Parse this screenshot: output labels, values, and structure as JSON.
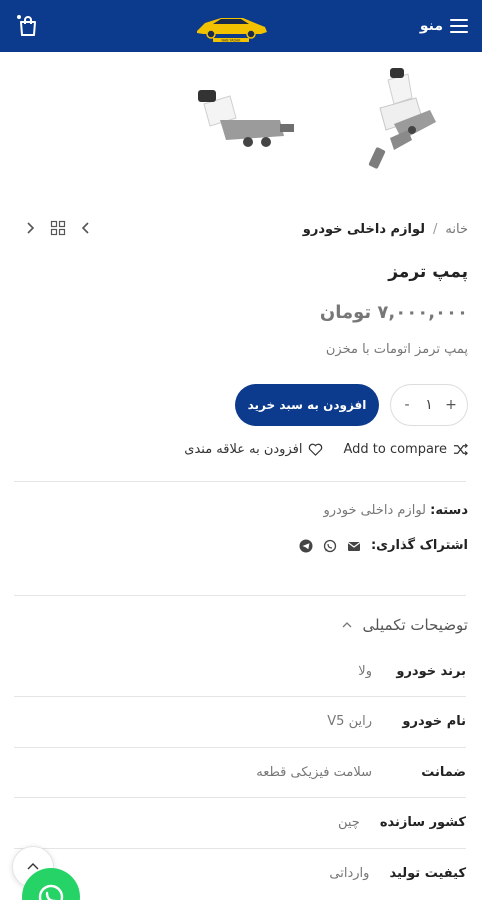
{
  "header": {
    "menu_label": "منو",
    "logo_text": "NAB YADAK",
    "bg_color": "#0c3a8c"
  },
  "breadcrumb": {
    "home": "خانه",
    "separator": "/",
    "category": "لوازم داخلی خودرو"
  },
  "product": {
    "title": "پمپ ترمز",
    "price": "۷,۰۰۰,۰۰۰ تومان",
    "short_description": "پمپ ترمز اتومات با مخزن",
    "quantity": "۱",
    "qty_minus": "-",
    "qty_plus": "+",
    "add_to_cart": "افزودن به سبد خرید",
    "compare": "Add to compare",
    "wishlist": "افزودن به علاقه مندی"
  },
  "meta": {
    "category_label": "دسته:",
    "category_value": "لوازم داخلی خودرو",
    "share_label": "اشتراک گذاری:"
  },
  "additional_info": {
    "title": "توضیحات تکمیلی",
    "attributes": [
      {
        "key": "برند خودرو",
        "value": "ولا"
      },
      {
        "key": "نام خودرو",
        "value": "راین V5"
      },
      {
        "key": "ضمانت",
        "value": "سلامت فیزیکی قطعه"
      },
      {
        "key": "کشور سازنده",
        "value": "چین"
      },
      {
        "key": "کیفیت تولید",
        "value": "وارداتی"
      }
    ]
  },
  "icons": {
    "menu": "hamburger-icon",
    "cart": "shopping-bag-icon",
    "prev": "chevron-right-icon",
    "grid": "grid-icon",
    "next": "chevron-left-icon",
    "compare": "shuffle-icon",
    "wishlist": "heart-icon",
    "email": "envelope-icon",
    "whatsapp": "whatsapp-icon",
    "telegram": "telegram-icon",
    "accordion": "chevron-up-icon"
  },
  "colors": {
    "primary": "#0c3a8c",
    "whatsapp": "#25d366"
  }
}
